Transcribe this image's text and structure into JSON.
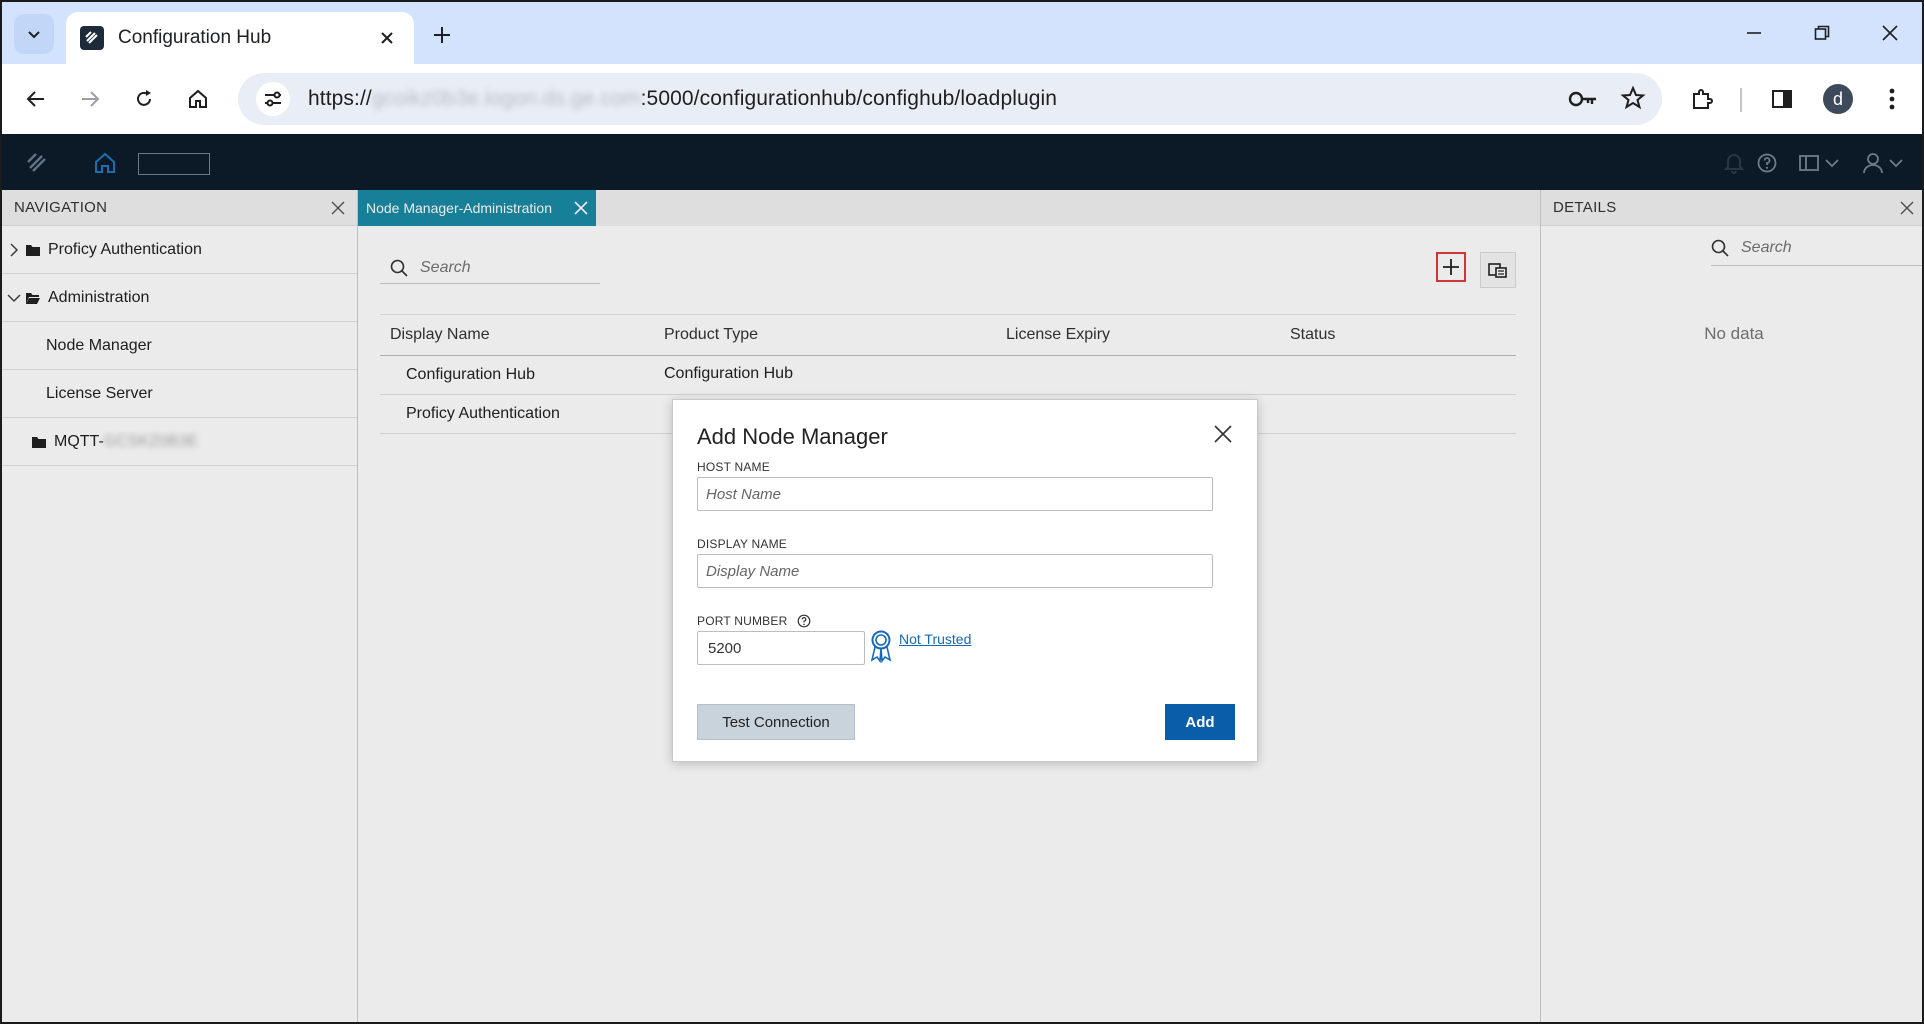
{
  "browser": {
    "tab_title": "Configuration Hub",
    "url_prefix": "https://",
    "url_blurred": "gcoikz0b3e.logon.ds.ge.com",
    "url_suffix": ":5000/configurationhub/confighub/loadplugin",
    "avatar_letter": "d"
  },
  "navigation": {
    "title": "NAVIGATION",
    "items": [
      {
        "label": "Proficy Authentication"
      },
      {
        "label": "Administration"
      },
      {
        "label": "Node Manager"
      },
      {
        "label": "License Server"
      },
      {
        "label": "MQTT-",
        "blurred": "GCSKZ0B3E"
      }
    ]
  },
  "main": {
    "tab_label": "Node Manager-Administration",
    "search_placeholder": "Search",
    "columns": [
      "Display Name",
      "Product Type",
      "License Expiry",
      "Status"
    ],
    "rows": [
      {
        "display_name": "Configuration Hub",
        "product_type": "Configuration Hub",
        "license_expiry": "",
        "status": ""
      },
      {
        "display_name": "Proficy Authentication",
        "product_type": "",
        "license_expiry": "",
        "status": ""
      }
    ]
  },
  "details": {
    "title": "DETAILS",
    "search_placeholder": "Search",
    "empty_text": "No data"
  },
  "modal": {
    "title": "Add Node Manager",
    "host_label": "HOST NAME",
    "host_placeholder": "Host Name",
    "display_label": "DISPLAY NAME",
    "display_placeholder": "Display Name",
    "port_label": "PORT NUMBER",
    "port_value": "5200",
    "trust_link": "Not Trusted",
    "test_button": "Test Connection",
    "add_button": "Add"
  },
  "colors": {
    "accent_tab": "#1a8aa4",
    "primary_button": "#0a5da8",
    "highlight_border": "#e03a3a",
    "appbar": "#0b1a26"
  }
}
